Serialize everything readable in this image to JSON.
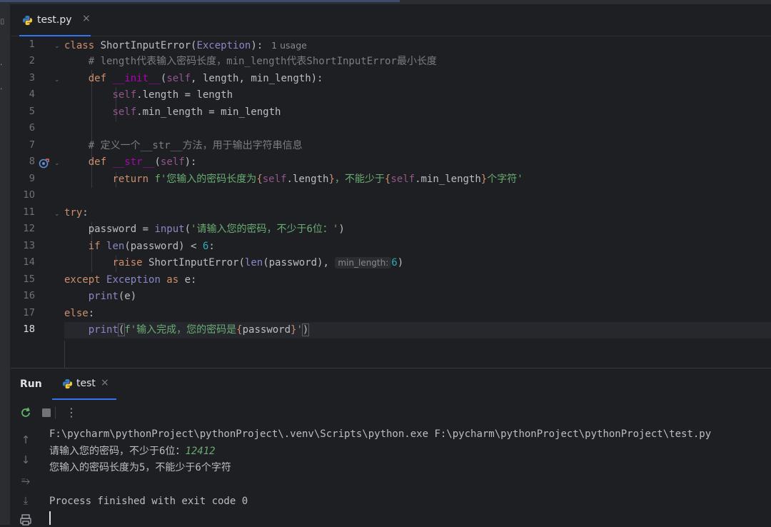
{
  "editor": {
    "tab": {
      "filename": "test.py",
      "close": "×"
    },
    "line_numbers": [
      "1",
      "2",
      "3",
      "4",
      "5",
      "6",
      "7",
      "8",
      "9",
      "10",
      "11",
      "12",
      "13",
      "14",
      "15",
      "16",
      "17",
      "18"
    ],
    "usage_hint": "1 usage",
    "param_hint": "min_length:",
    "code": {
      "l1": {
        "kw": "class",
        "name": " ShortInputError(",
        "base": "Exception",
        "end": "):"
      },
      "l2": "    # length代表输入密码长度，min_length代表ShortInputError最小长度",
      "l3": {
        "indent": "    ",
        "kw": "def",
        "sp": " ",
        "fn": "__init__",
        "p1": "(",
        "self": "self",
        "rest": ", length, min_length):"
      },
      "l4": {
        "indent": "        ",
        "self": "self",
        "rest": ".length = length"
      },
      "l5": {
        "indent": "        ",
        "self": "self",
        "rest": ".min_length = min_length"
      },
      "l7": "    # 定义一个__str__方法，用于输出字符串信息",
      "l8": {
        "indent": "    ",
        "kw": "def",
        "sp": " ",
        "fn": "__str__",
        "p1": "(",
        "self": "self",
        "rest": "):"
      },
      "l9": {
        "indent": "        ",
        "kw": "return",
        "s1": " f'您输入的密码长度为",
        "b1": "{",
        "self1": "self",
        "v1": ".length",
        "b2": "}",
        "s2": "，不能少于",
        "b3": "{",
        "self2": "self",
        "v2": ".min_length",
        "b4": "}",
        "s3": "个字符'"
      },
      "l11": {
        "kw": "try",
        "rest": ":"
      },
      "l12": {
        "indent": "    ",
        "var": "password = ",
        "fn": "input",
        "p": "(",
        "str": "'请输入您的密码，不少于6位：'",
        "end": ")"
      },
      "l13": {
        "indent": "    ",
        "kw": "if",
        "sp": " ",
        "fn": "len",
        "rest": "(password) < ",
        "num": "6",
        "end": ":"
      },
      "l14": {
        "indent": "        ",
        "kw": "raise",
        "rest": " ShortInputError(",
        "fn": "len",
        "rest2": "(password), ",
        "num": "6",
        "end": ")"
      },
      "l15": {
        "kw": "except",
        "sp": " ",
        "cls": "Exception",
        "kw2": " as",
        "rest": " e:"
      },
      "l16": {
        "indent": "    ",
        "fn": "print",
        "rest": "(e)"
      },
      "l17": {
        "kw": "else",
        "rest": ":"
      },
      "l18": {
        "indent": "    ",
        "fn": "print",
        "p": "(",
        "s1": "f'输入完成，您的密码是",
        "b1": "{",
        "v": "password",
        "b2": "}",
        "s2": "'",
        "end": ")"
      }
    }
  },
  "run": {
    "title": "Run",
    "tab": {
      "name": "test",
      "close": "×"
    },
    "console": {
      "cmd": "F:\\pycharm\\pythonProject\\pythonProject\\.venv\\Scripts\\python.exe F:\\pycharm\\pythonProject\\pythonProject\\test.py",
      "prompt": "请输入您的密码，不少于6位：",
      "input_value": "12412",
      "output": "您输入的密码长度为5，不能少于6个字符",
      "exit": "Process finished with exit code 0"
    }
  },
  "icons": {
    "python": "python-file-icon",
    "rerun": "rerun-icon",
    "stop": "stop-icon",
    "more": "more-vertical-icon",
    "up": "arrow-up-icon",
    "down": "arrow-down-icon",
    "wrap": "soft-wrap-icon",
    "scroll": "scroll-to-end-icon",
    "print": "print-icon",
    "override": "override-marker-icon"
  },
  "colors": {
    "accent": "#3574f0",
    "keyword": "#cf8e6d",
    "string": "#6aab73",
    "function": "#56a8f5",
    "self": "#94558d",
    "number": "#2aacb8"
  }
}
